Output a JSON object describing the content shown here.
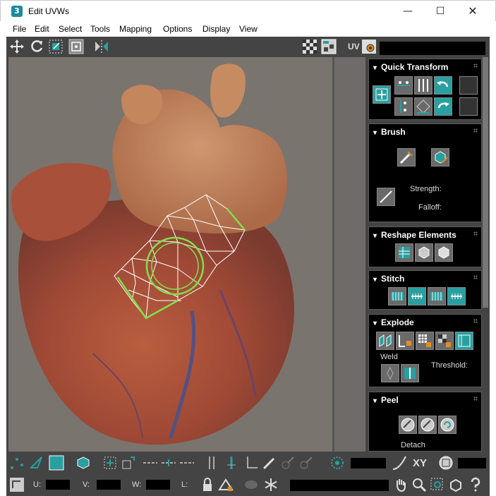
{
  "window": {
    "title": "Edit UVWs",
    "app_icon_glyph": "3",
    "minimize_glyph": "—",
    "maximize_glyph": "☐",
    "close_glyph": "✕"
  },
  "menu": [
    "File",
    "Edit",
    "Select",
    "Tools",
    "Mapping",
    "Options",
    "Display",
    "View"
  ],
  "toolbar": {
    "uv_label": "UV",
    "icons": [
      "move-icon",
      "rotate-icon",
      "scale-icon",
      "freeform-icon",
      "mirror-icon",
      "checker-icon",
      "checker-texture-icon",
      "uv-settings-icon"
    ]
  },
  "panels": {
    "quick_transform": {
      "title": "Quick Transform"
    },
    "brush": {
      "title": "Brush",
      "strength_label": "Strength:",
      "falloff_label": "Falloff:"
    },
    "reshape": {
      "title": "Reshape Elements"
    },
    "stitch": {
      "title": "Stitch"
    },
    "explode": {
      "title": "Explode",
      "weld_label": "Weld",
      "threshold_label": "Threshold:"
    },
    "peel": {
      "title": "Peel",
      "detach_label": "Detach"
    }
  },
  "bottom": {
    "coords": {
      "u_label": "U:",
      "v_label": "V:",
      "w_label": "W:",
      "l_label": "L:"
    },
    "xy_label": "XY"
  },
  "colors": {
    "panel_bg": "#444444",
    "accent_teal": "#2a9fa0",
    "wireframe": "#ffffff",
    "selection_green": "#7fe04a"
  }
}
